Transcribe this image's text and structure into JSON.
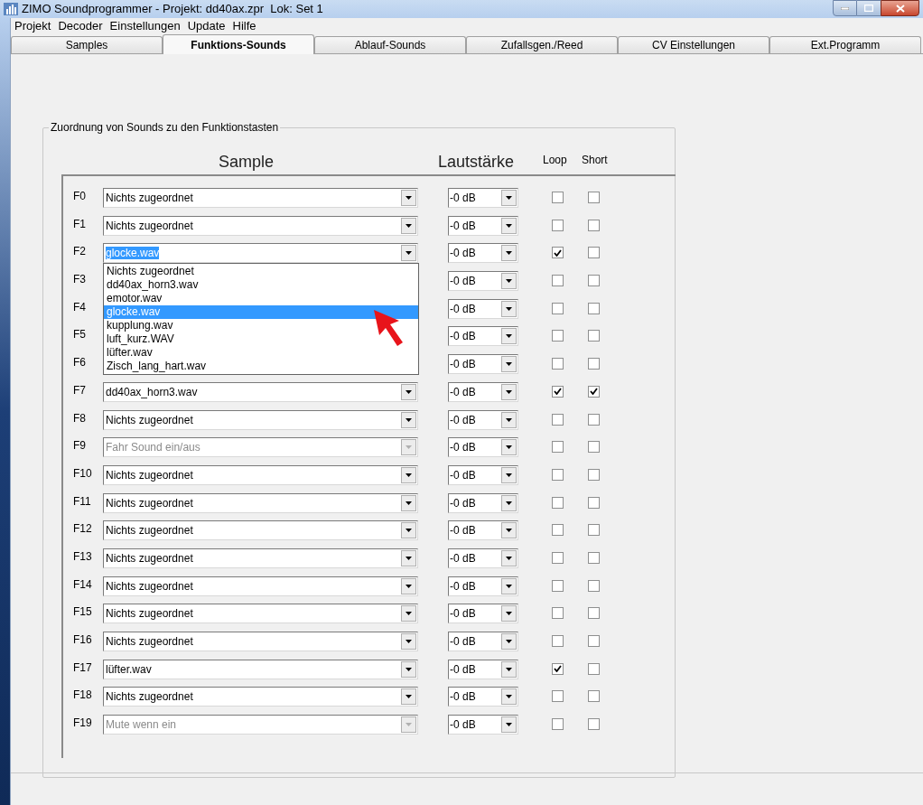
{
  "window": {
    "title": "ZIMO Soundprogrammer - Projekt: dd40ax.zpr  Lok: Set 1"
  },
  "menu": [
    "Projekt",
    "Decoder",
    "Einstellungen",
    "Update",
    "Hilfe"
  ],
  "tabs": [
    {
      "label": "Samples",
      "selected": false
    },
    {
      "label": "Funktions-Sounds",
      "selected": true
    },
    {
      "label": "Ablauf-Sounds",
      "selected": false
    },
    {
      "label": "Zufallsgen./Reed",
      "selected": false
    },
    {
      "label": "CV Einstellungen",
      "selected": false
    },
    {
      "label": "Ext.Programm",
      "selected": false
    }
  ],
  "group": {
    "title": "Zuordnung von Sounds zu den Funktionstasten",
    "headers": [
      "Sample",
      "Lautstärke",
      "Loop",
      "Short"
    ]
  },
  "rows": [
    {
      "key": "F0",
      "sample": "Nichts zugeordnet",
      "disabled": false,
      "text_selected": false,
      "volume": "-0 dB",
      "loop": false,
      "short": false
    },
    {
      "key": "F1",
      "sample": "Nichts zugeordnet",
      "disabled": false,
      "text_selected": false,
      "volume": "-0 dB",
      "loop": false,
      "short": false
    },
    {
      "key": "F2",
      "sample": "glocke.wav",
      "disabled": false,
      "text_selected": true,
      "volume": "-0 dB",
      "loop": true,
      "short": false
    },
    {
      "key": "F3",
      "volume": "-0 dB",
      "loop": false,
      "short": false
    },
    {
      "key": "F4",
      "volume": "-0 dB",
      "loop": false,
      "short": false
    },
    {
      "key": "F5",
      "volume": "-0 dB",
      "loop": false,
      "short": false
    },
    {
      "key": "F6",
      "volume": "-0 dB",
      "loop": false,
      "short": false
    },
    {
      "key": "F7",
      "sample": "dd40ax_horn3.wav",
      "disabled": false,
      "text_selected": false,
      "volume": "-0 dB",
      "loop": true,
      "short": true
    },
    {
      "key": "F8",
      "sample": "Nichts zugeordnet",
      "disabled": false,
      "text_selected": false,
      "volume": "-0 dB",
      "loop": false,
      "short": false
    },
    {
      "key": "F9",
      "sample": "Fahr Sound ein/aus",
      "disabled": true,
      "text_selected": false,
      "volume": "-0 dB",
      "loop": false,
      "short": false
    },
    {
      "key": "F10",
      "sample": "Nichts zugeordnet",
      "disabled": false,
      "text_selected": false,
      "volume": "-0 dB",
      "loop": false,
      "short": false
    },
    {
      "key": "F11",
      "sample": "Nichts zugeordnet",
      "disabled": false,
      "text_selected": false,
      "volume": "-0 dB",
      "loop": false,
      "short": false
    },
    {
      "key": "F12",
      "sample": "Nichts zugeordnet",
      "disabled": false,
      "text_selected": false,
      "volume": "-0 dB",
      "loop": false,
      "short": false
    },
    {
      "key": "F13",
      "sample": "Nichts zugeordnet",
      "disabled": false,
      "text_selected": false,
      "volume": "-0 dB",
      "loop": false,
      "short": false
    },
    {
      "key": "F14",
      "sample": "Nichts zugeordnet",
      "disabled": false,
      "text_selected": false,
      "volume": "-0 dB",
      "loop": false,
      "short": false
    },
    {
      "key": "F15",
      "sample": "Nichts zugeordnet",
      "disabled": false,
      "text_selected": false,
      "volume": "-0 dB",
      "loop": false,
      "short": false
    },
    {
      "key": "F16",
      "sample": "Nichts zugeordnet",
      "disabled": false,
      "text_selected": false,
      "volume": "-0 dB",
      "loop": false,
      "short": false
    },
    {
      "key": "F17",
      "sample": "lüfter.wav",
      "disabled": false,
      "text_selected": false,
      "volume": "-0 dB",
      "loop": true,
      "short": false
    },
    {
      "key": "F18",
      "sample": "Nichts zugeordnet",
      "disabled": false,
      "text_selected": false,
      "volume": "-0 dB",
      "loop": false,
      "short": false
    },
    {
      "key": "F19",
      "sample": "Mute wenn ein",
      "disabled": true,
      "text_selected": false,
      "volume": "-0 dB",
      "loop": false,
      "short": false
    }
  ],
  "dropdown": {
    "items": [
      {
        "label": "Nichts zugeordnet",
        "selected": false
      },
      {
        "label": "dd40ax_horn3.wav",
        "selected": false
      },
      {
        "label": "emotor.wav",
        "selected": false
      },
      {
        "label": "glocke.wav",
        "selected": true
      },
      {
        "label": "kupplung.wav",
        "selected": false
      },
      {
        "label": "luft_kurz.WAV",
        "selected": false
      },
      {
        "label": "lüfter.wav",
        "selected": false
      },
      {
        "label": "Zisch_lang_hart.wav",
        "selected": false
      }
    ]
  }
}
